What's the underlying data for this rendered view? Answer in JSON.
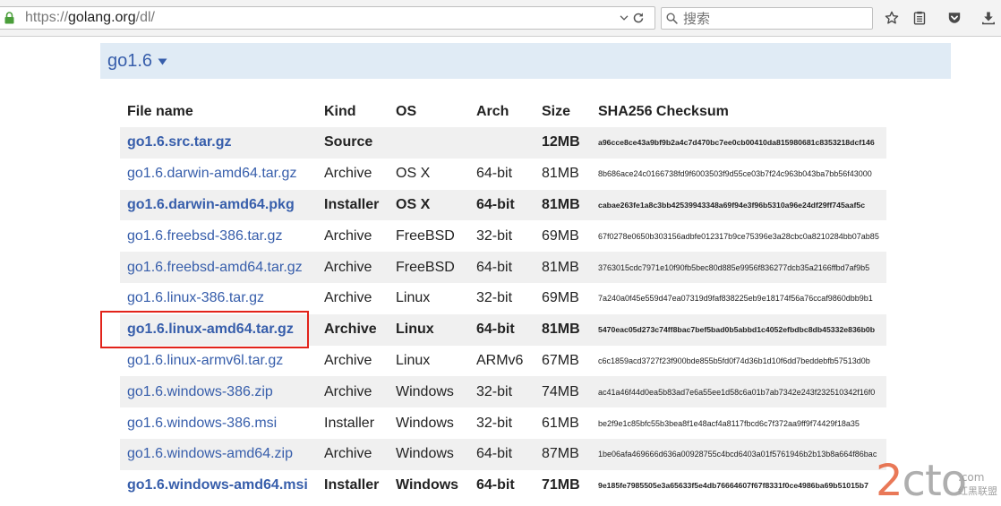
{
  "browser": {
    "url_scheme": "https://",
    "url_host": "golang.org",
    "url_path": "/dl/",
    "search_placeholder": "搜索"
  },
  "icons": {
    "security": "lock-icon",
    "url_history": "chevron-down-icon",
    "reload": "reload-icon",
    "search": "search-icon",
    "bookmark": "star-icon",
    "reading_list": "reading-list-icon",
    "pocket": "pocket-icon",
    "downloads": "download-icon",
    "version_toggle": "triangle-down-icon"
  },
  "colors": {
    "link": "#375eab",
    "version_header_bg": "#e0ebf5",
    "row_stripe": "#f0f0f0",
    "annotation_box": "#e2231a",
    "secure_lock": "#4a9e3a"
  },
  "version_header": {
    "title": "go1.6"
  },
  "table": {
    "columns": [
      "File name",
      "Kind",
      "OS",
      "Arch",
      "Size",
      "SHA256 Checksum"
    ],
    "rows": [
      {
        "file": "go1.6.src.tar.gz",
        "kind": "Source",
        "os": "",
        "arch": "",
        "size": "12MB",
        "sha256": "a96cce8ce43a9bf9b2a4c7d470bc7ee0cb00410da815980681c8353218dcf146",
        "featured": true
      },
      {
        "file": "go1.6.darwin-amd64.tar.gz",
        "kind": "Archive",
        "os": "OS X",
        "arch": "64-bit",
        "size": "81MB",
        "sha256": "8b686ace24c0166738fd9f6003503f9d55ce03b7f24c963b043ba7bb56f43000",
        "featured": false
      },
      {
        "file": "go1.6.darwin-amd64.pkg",
        "kind": "Installer",
        "os": "OS X",
        "arch": "64-bit",
        "size": "81MB",
        "sha256": "cabae263fe1a8c3bb42539943348a69f94e3f96b5310a96e24df29ff745aaf5c",
        "featured": true
      },
      {
        "file": "go1.6.freebsd-386.tar.gz",
        "kind": "Archive",
        "os": "FreeBSD",
        "arch": "32-bit",
        "size": "69MB",
        "sha256": "67f0278e0650b303156adbfe012317b9ce75396e3a28cbc0a8210284bb07ab85",
        "featured": false
      },
      {
        "file": "go1.6.freebsd-amd64.tar.gz",
        "kind": "Archive",
        "os": "FreeBSD",
        "arch": "64-bit",
        "size": "81MB",
        "sha256": "3763015cdc7971e10f90fb5bec80d885e9956f836277dcb35a2166ffbd7af9b5",
        "featured": false
      },
      {
        "file": "go1.6.linux-386.tar.gz",
        "kind": "Archive",
        "os": "Linux",
        "arch": "32-bit",
        "size": "69MB",
        "sha256": "7a240a0f45e559d47ea07319d9faf838225eb9e18174f56a76ccaf9860dbb9b1",
        "featured": false
      },
      {
        "file": "go1.6.linux-amd64.tar.gz",
        "kind": "Archive",
        "os": "Linux",
        "arch": "64-bit",
        "size": "81MB",
        "sha256": "5470eac05d273c74ff8bac7bef5bad0b5abbd1c4052efbdbc8db45332e836b0b",
        "featured": true
      },
      {
        "file": "go1.6.linux-armv6l.tar.gz",
        "kind": "Archive",
        "os": "Linux",
        "arch": "ARMv6",
        "size": "67MB",
        "sha256": "c6c1859acd3727f23f900bde855b5fd0f74d36b1d10f6dd7beddebfb57513d0b",
        "featured": false
      },
      {
        "file": "go1.6.windows-386.zip",
        "kind": "Archive",
        "os": "Windows",
        "arch": "32-bit",
        "size": "74MB",
        "sha256": "ac41a46f44d0ea5b83ad7e6a55ee1d58c6a01b7ab7342e243f232510342f16f0",
        "featured": false
      },
      {
        "file": "go1.6.windows-386.msi",
        "kind": "Installer",
        "os": "Windows",
        "arch": "32-bit",
        "size": "61MB",
        "sha256": "be2f9e1c85bfc55b3bea8f1e48acf4a8117fbcd6c7f372aa9ff9f74429f18a35",
        "featured": false
      },
      {
        "file": "go1.6.windows-amd64.zip",
        "kind": "Archive",
        "os": "Windows",
        "arch": "64-bit",
        "size": "87MB",
        "sha256": "1be06afa469666d636a00928755c4bcd6403a01f5761946b2b13b8a664f86bac",
        "featured": false
      },
      {
        "file": "go1.6.windows-amd64.msi",
        "kind": "Installer",
        "os": "Windows",
        "arch": "64-bit",
        "size": "71MB",
        "sha256": "9e185fe7985505e3a65633f5e4db76664607f67f8331f0ce4986ba69b51015b7",
        "featured": true
      }
    ]
  },
  "watermark": {
    "logo": "2cto",
    "suffix": ".com",
    "name": "红黑联盟"
  }
}
